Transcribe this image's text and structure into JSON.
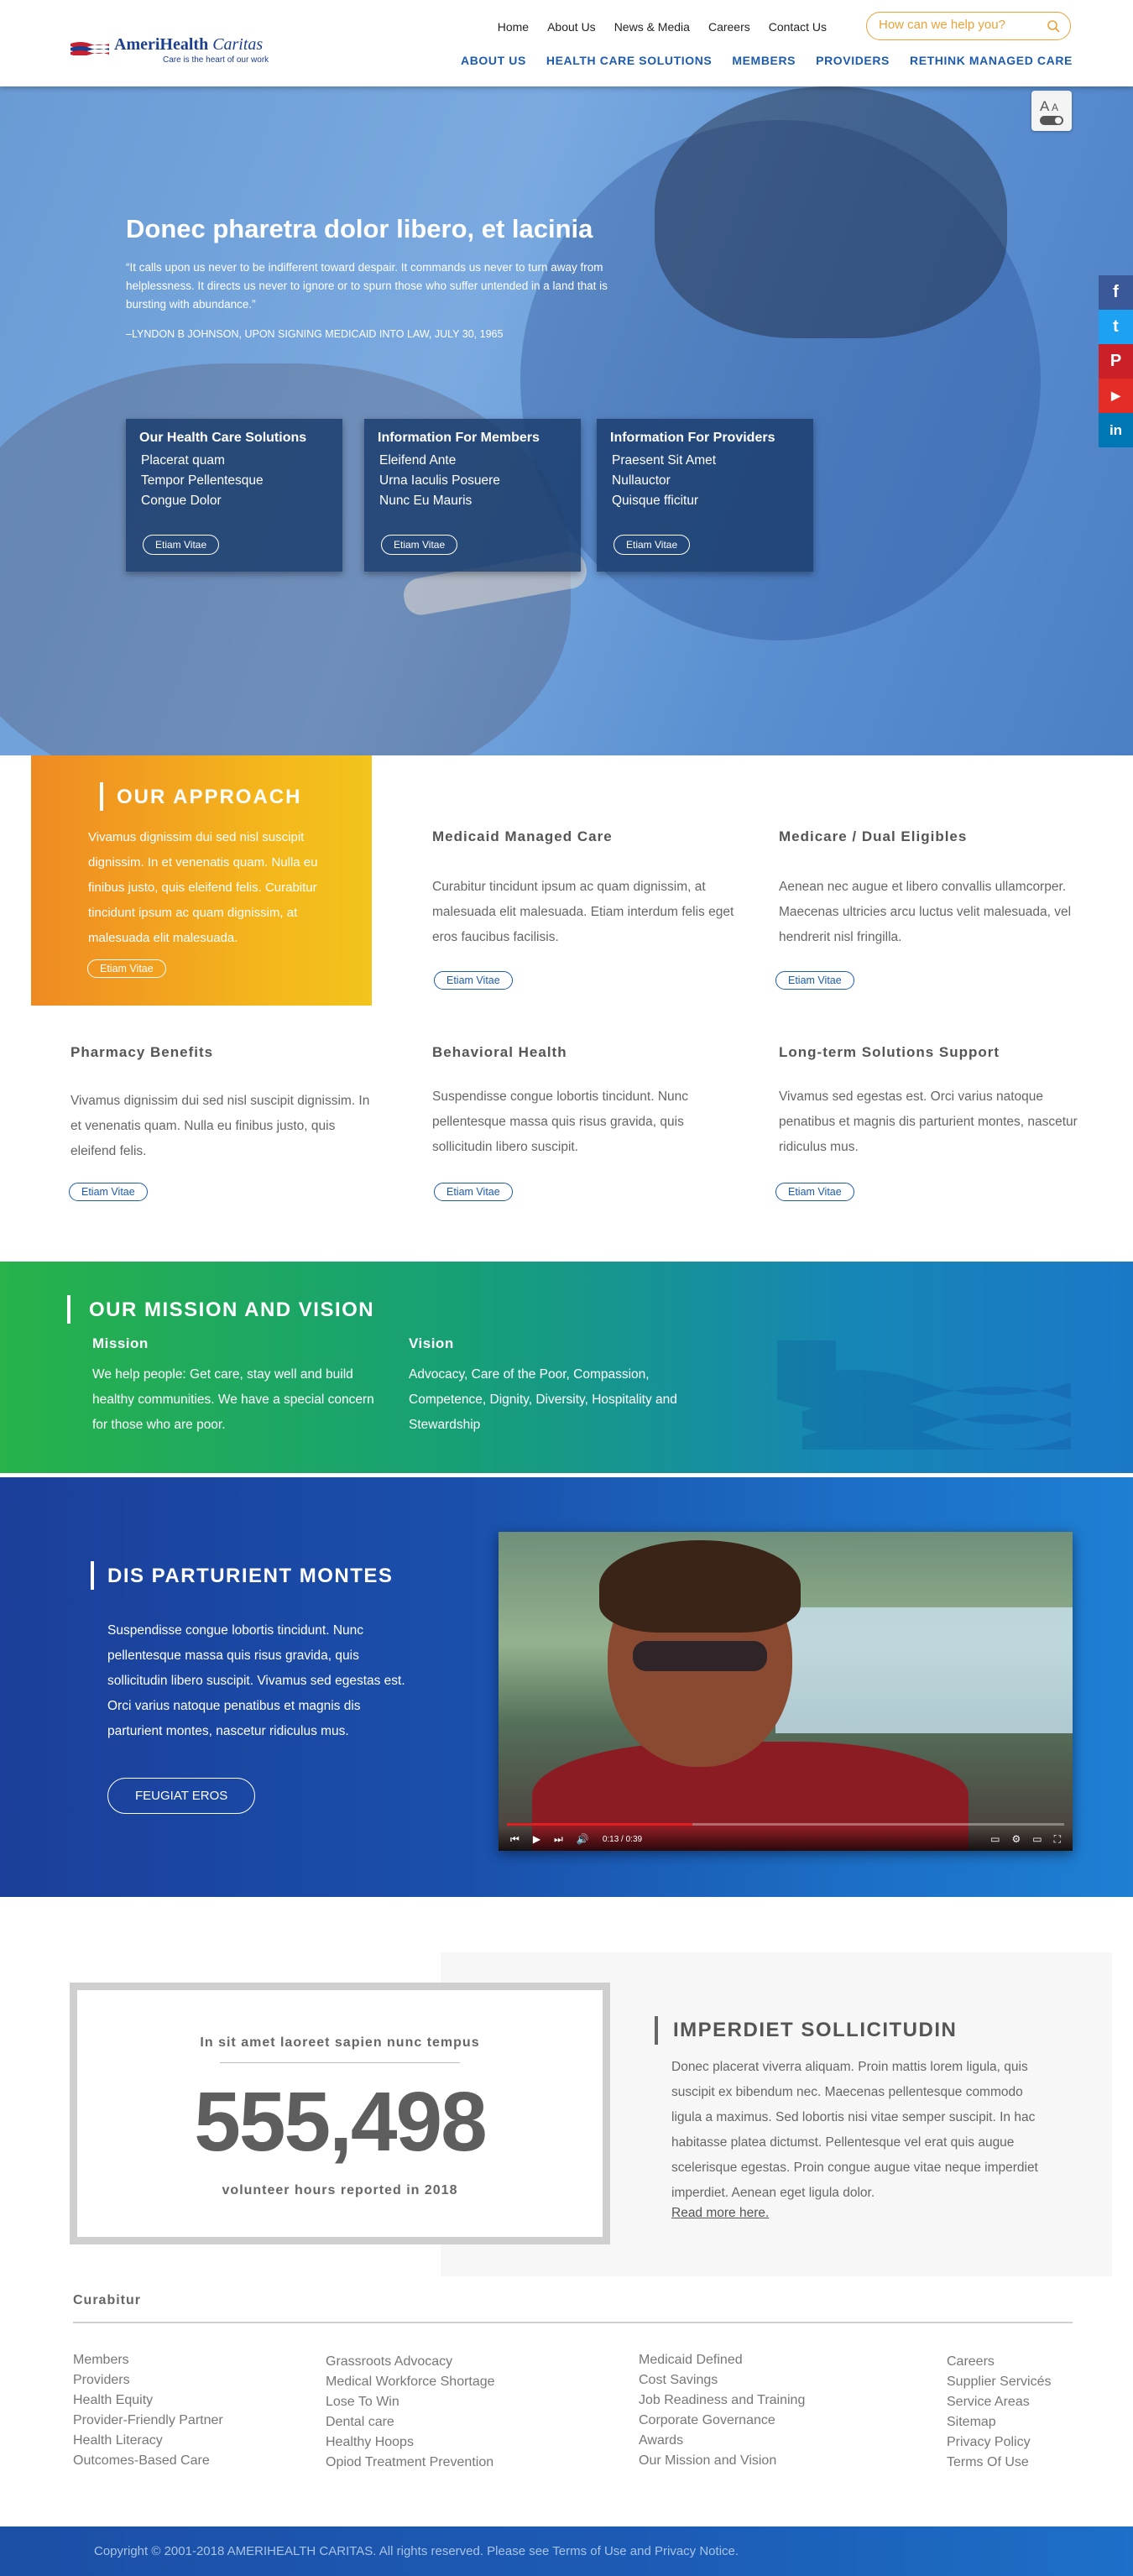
{
  "header": {
    "logo_name": "AmeriHealth",
    "logo_name_italic": "Caritas",
    "logo_tagline": "Care is the heart of our work",
    "top_nav": [
      "Home",
      "About Us",
      "News & Media",
      "Careers",
      "Contact Us"
    ],
    "search_placeholder": "How can we help you?",
    "main_nav": [
      "ABOUT US",
      "HEALTH CARE SOLUTIONS",
      "MEMBERS",
      "PROVIDERS",
      "RETHINK MANAGED CARE"
    ]
  },
  "hero": {
    "title": "Donec pharetra dolor libero, et lacinia",
    "quote": "“It calls upon us never to be indifferent toward despair. It commands us never to turn away from helplessness. It directs us never to ignore or to spurn those who suffer untended in a land that is bursting with abundance.”",
    "attribution": "–LYNDON B JOHNSON, UPON SIGNING MEDICAID INTO LAW, JULY 30, 1965",
    "cards": [
      {
        "title": "Our Health Care Solutions",
        "lines": [
          "Placerat quam",
          "Tempor Pellentesque",
          "Congue Dolor"
        ],
        "button": "Etiam Vitae"
      },
      {
        "title": "Information For Members",
        "lines": [
          "Eleifend Ante",
          "Urna Iaculis Posuere",
          "Nunc Eu Mauris"
        ],
        "button": "Etiam Vitae"
      },
      {
        "title": "Information For Providers",
        "lines": [
          "Praesent Sit Amet",
          "Nullauctor",
          "Quisque fficitur"
        ],
        "button": "Etiam Vitae"
      }
    ]
  },
  "social": [
    {
      "icon": "facebook-icon",
      "glyph": "f",
      "color": "#3b5998"
    },
    {
      "icon": "twitter-icon",
      "glyph": "t",
      "color": "#1da1f2"
    },
    {
      "icon": "pinterest-icon",
      "glyph": "P",
      "color": "#cb2027"
    },
    {
      "icon": "youtube-icon",
      "glyph": "▶",
      "color": "#e52d27"
    },
    {
      "icon": "linkedin-icon",
      "glyph": "in",
      "color": "#0077b5"
    }
  ],
  "approach": {
    "title": "OUR APPROACH",
    "text": "Vivamus dignissim dui sed nisl suscipit dignissim. In et venenatis quam. Nulla eu finibus justo, quis eleifend felis. Curabitur tincidunt ipsum ac quam dignissim, at malesuada elit malesuada.",
    "button": "Etiam Vitae"
  },
  "services": [
    {
      "title": "Medicaid Managed Care",
      "text": "Curabitur tincidunt ipsum ac quam dignissim, at malesuada elit malesuada. Etiam interdum felis eget eros faucibus facilisis.",
      "button": "Etiam Vitae"
    },
    {
      "title": "Medicare / Dual Eligibles",
      "text": "Aenean nec augue et libero convallis ullamcorper. Maecenas ultricies arcu luctus velit malesuada, vel hendrerit nisl fringilla.",
      "button": "Etiam Vitae"
    },
    {
      "title": "Pharmacy Benefits",
      "text": "Vivamus dignissim dui sed nisl suscipit dignissim. In et venenatis quam. Nulla eu finibus justo, quis eleifend felis.",
      "button": "Etiam Vitae"
    },
    {
      "title": "Behavioral Health",
      "text": "Suspendisse congue lobortis tincidunt. Nunc pellentesque massa quis risus gravida, quis sollicitudin libero suscipit.",
      "button": "Etiam Vitae"
    },
    {
      "title": "Long-term Solutions Support",
      "text": " Vivamus sed egestas est. Orci varius natoque penatibus et magnis dis parturient montes, nascetur ridiculus mus.",
      "button": "Etiam Vitae"
    }
  ],
  "mission": {
    "title": "OUR MISSION AND VISION",
    "mission_label": "Mission",
    "mission_text": "We help people: Get care, stay well and build healthy communities. We have a special concern for those who are poor.",
    "vision_label": "Vision",
    "vision_text": "Advocacy, Care of the Poor, Compassion, Competence, Dignity, Diversity, Hospitality and Stewardship"
  },
  "video_section": {
    "title": "DIS PARTURIENT MONTES",
    "text": "Suspendisse congue lobortis tincidunt. Nunc pellentesque massa quis risus gravida, quis sollicitudin libero suscipit. Vivamus sed egestas est. Orci varius natoque penatibus et magnis dis parturient montes, nascetur ridiculus mus.",
    "button": "FEUGIAT EROS",
    "time": "0:13 / 0:39",
    "progress": 0.333
  },
  "stats": {
    "heading": "In sit amet laoreet sapien nunc tempus",
    "number": "555,498",
    "caption": "volunteer hours reported in 2018"
  },
  "imperdiet": {
    "title": "IMPERDIET SOLLICITUDIN",
    "text": "Donec placerat viverra aliquam. Proin mattis lorem ligula, quis suscipit ex bibendum nec. Maecenas pellentesque commodo ligula a maximus. Sed lobortis nisi vitae semper suscipit. In hac habitasse platea dictumst. Pellentesque vel erat quis augue scelerisque egestas. Proin congue augue vitae neque imperdiet imperdiet. Aenean eget ligula dolor.",
    "link": "Read more here."
  },
  "footer": {
    "title": "Curabitur",
    "columns": [
      [
        "Members",
        "Providers",
        "Health Equity",
        "Provider-Friendly Partner",
        "Health Literacy",
        "Outcomes-Based Care"
      ],
      [
        "Grassroots Advocacy",
        "Medical Workforce Shortage",
        "Lose To Win",
        "Dental care",
        "Healthy Hoops",
        "Opiod Treatment Prevention"
      ],
      [
        "Medicaid Defined",
        "Cost Savings",
        "Job Readiness and Training",
        "Corporate Governance",
        "Awards",
        "Our Mission and Vision"
      ],
      [
        "Careers",
        "Supplier Servicés",
        "Service Areas",
        "Sitemap",
        "Privacy Policy",
        "Terms Of Use"
      ]
    ],
    "copyright": "Copyright © 2001-2018 AMERIHEALTH CARITAS. All rights reserved. Please see Terms of Use and Privacy Notice."
  },
  "colors": {
    "brand_blue": "#1d5bb0",
    "accent_orange": "#e8a23a",
    "approach_gradient_start": "#ef8a23",
    "mission_green": "#27b24a"
  }
}
